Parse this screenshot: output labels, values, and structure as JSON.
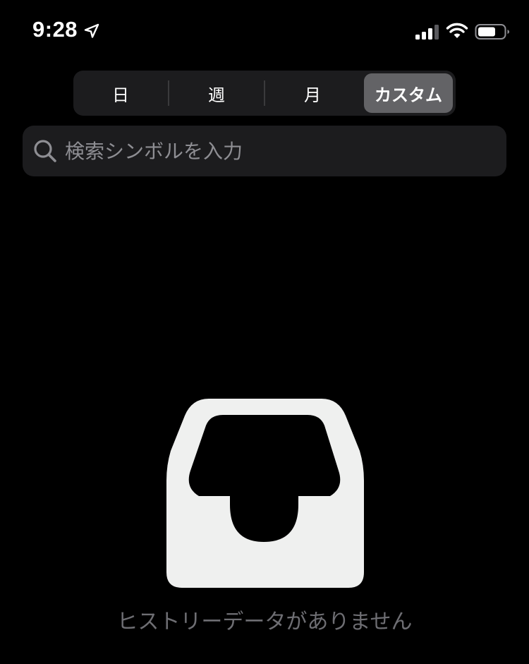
{
  "status_bar": {
    "time": "9:28",
    "icons": [
      "location-arrow-icon",
      "cellular-signal-icon",
      "wifi-icon",
      "battery-icon"
    ]
  },
  "segmented_control": {
    "segments": [
      {
        "label": "日"
      },
      {
        "label": "週"
      },
      {
        "label": "月"
      },
      {
        "label": "カスタム"
      }
    ],
    "selected": "カスタム"
  },
  "search": {
    "placeholder": "検索シンボルを入力",
    "value": ""
  },
  "empty_state": {
    "icon": "tray-icon",
    "message": "ヒストリーデータがありません"
  },
  "colors": {
    "background": "#000000",
    "control_background": "#1c1c1e",
    "selected_segment": "#636366",
    "placeholder": "#8e8e93",
    "empty_icon": "#eff0ef",
    "empty_text": "#6e6e73"
  }
}
